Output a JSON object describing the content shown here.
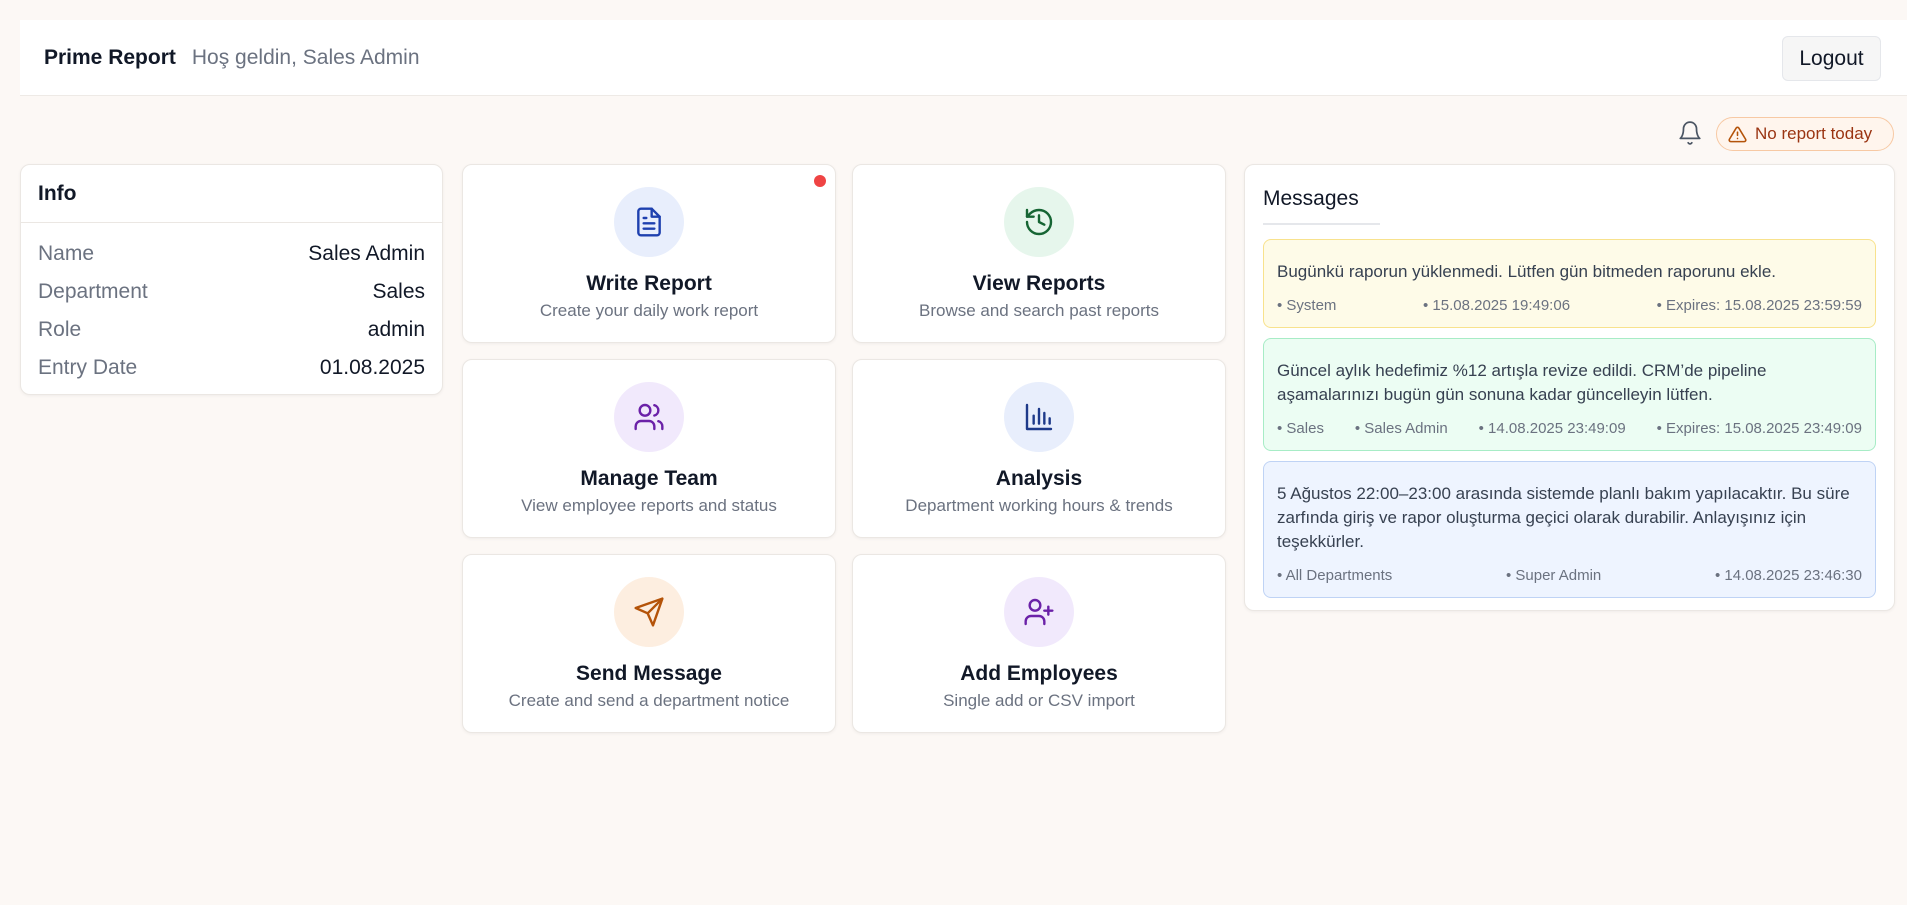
{
  "header": {
    "brand": "Prime Report",
    "greeting": "Hoş geldin, Sales Admin",
    "logout_label": "Logout"
  },
  "notification": {
    "bell_icon": "bell-icon",
    "badge_icon": "warning-triangle-icon",
    "badge_text": "No report today"
  },
  "info": {
    "title": "Info",
    "rows": [
      {
        "label": "Name",
        "value": "Sales Admin"
      },
      {
        "label": "Department",
        "value": "Sales"
      },
      {
        "label": "Role",
        "value": "admin"
      },
      {
        "label": "Entry Date",
        "value": "01.08.2025"
      }
    ]
  },
  "actions": [
    {
      "title": "Write Report",
      "subtitle": "Create your daily work report",
      "icon": "document-icon",
      "has_dot": true
    },
    {
      "title": "View Reports",
      "subtitle": "Browse and search past reports",
      "icon": "history-icon"
    },
    {
      "title": "Manage Team",
      "subtitle": "View employee reports and status",
      "icon": "users-icon"
    },
    {
      "title": "Analysis",
      "subtitle": "Department working hours & trends",
      "icon": "bar-chart-icon"
    },
    {
      "title": "Send Message",
      "subtitle": "Create and send a department notice",
      "icon": "send-icon"
    },
    {
      "title": "Add Employees",
      "subtitle": "Single add or CSV import",
      "icon": "user-plus-icon"
    }
  ],
  "messages": {
    "title": "Messages",
    "items": [
      {
        "text": "Bugünkü raporun yüklenmedi. Lütfen gün bitmeden raporunu ekle.",
        "meta": [
          "• System",
          "• 15.08.2025 19:49:06",
          "• Expires: 15.08.2025 23:59:59"
        ]
      },
      {
        "text": "Güncel aylık hedefimiz %12 artışla revize edildi. CRM’de pipeline aşamalarınızı bugün gün sonuna kadar güncelleyin lütfen.",
        "meta": [
          "• Sales",
          "• Sales Admin",
          "• 14.08.2025 23:49:09",
          "• Expires: 15.08.2025 23:49:09"
        ]
      },
      {
        "text": "5 Ağustos 22:00–23:00 arasında sistemde planlı bakım yapılacaktır. Bu süre zarfında giriş ve rapor oluşturma geçici olarak durabilir. Anlayışınız için teşekkürler.",
        "meta": [
          "• All Departments",
          "• Super Admin",
          "• 14.08.2025 23:46:30"
        ]
      }
    ]
  },
  "colors": {
    "background": "#fcf8f5",
    "alert_text": "#9a3412",
    "notification_dot": "#ef4444"
  }
}
